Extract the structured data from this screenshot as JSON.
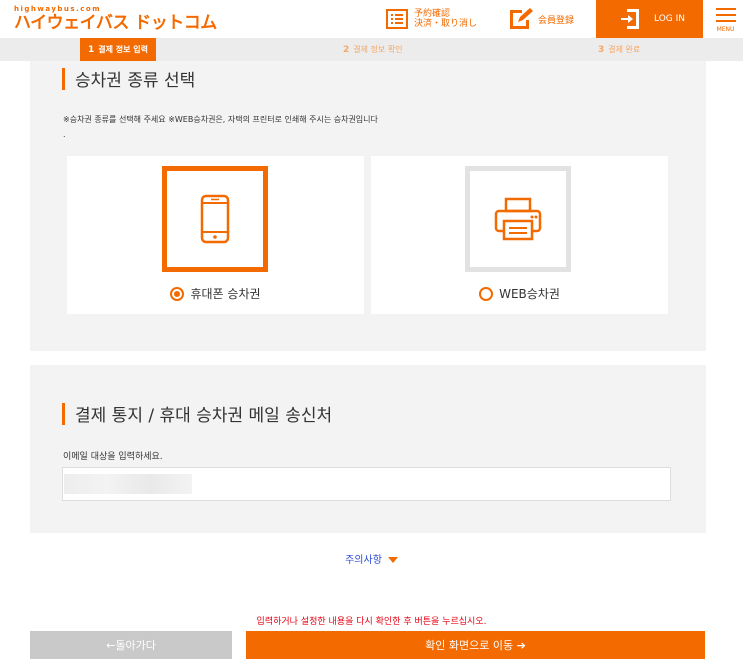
{
  "header": {
    "logo_small": "highwaybus.com",
    "logo_big": "ハイウェイバス ドットコム",
    "reserve_line1": "予約確認",
    "reserve_line2": "決済・取り消し",
    "member_register": "会員登録",
    "login": "LOG IN",
    "menu": "MENU"
  },
  "steps": [
    {
      "num": "1",
      "label": "결제 정보 입력"
    },
    {
      "num": "2",
      "label": "결제 정보 확인"
    },
    {
      "num": "3",
      "label": "결제 완료"
    }
  ],
  "ticket_section": {
    "title": "승차권 종류 선택",
    "note": "※승차권 종류를 선택해 주세요 ※WEB승차권은, 자택의 프린터로 인쇄해 주시는 승차권입니다",
    "note_tail": ".",
    "options": [
      {
        "label": "휴대폰 승차권",
        "icon": "smartphone-icon",
        "selected": true
      },
      {
        "label": "WEB승차권",
        "icon": "printer-icon",
        "selected": false
      }
    ]
  },
  "email_section": {
    "title": "결제 통지 / 휴대 승차권 메일 송신처",
    "label": "이메일 대상을 입력하세요."
  },
  "caution": "주의사항",
  "confirm_message": "입력하거나 설정한 내용을 다시 확인한 후 버튼을 누르십시오.",
  "buttons": {
    "back": "←돌아가다",
    "next": "확인 화면으로 이동 ➔"
  },
  "colors": {
    "accent": "#f26a00",
    "notice_red": "#e60012",
    "link_blue": "#2b4bd8"
  }
}
